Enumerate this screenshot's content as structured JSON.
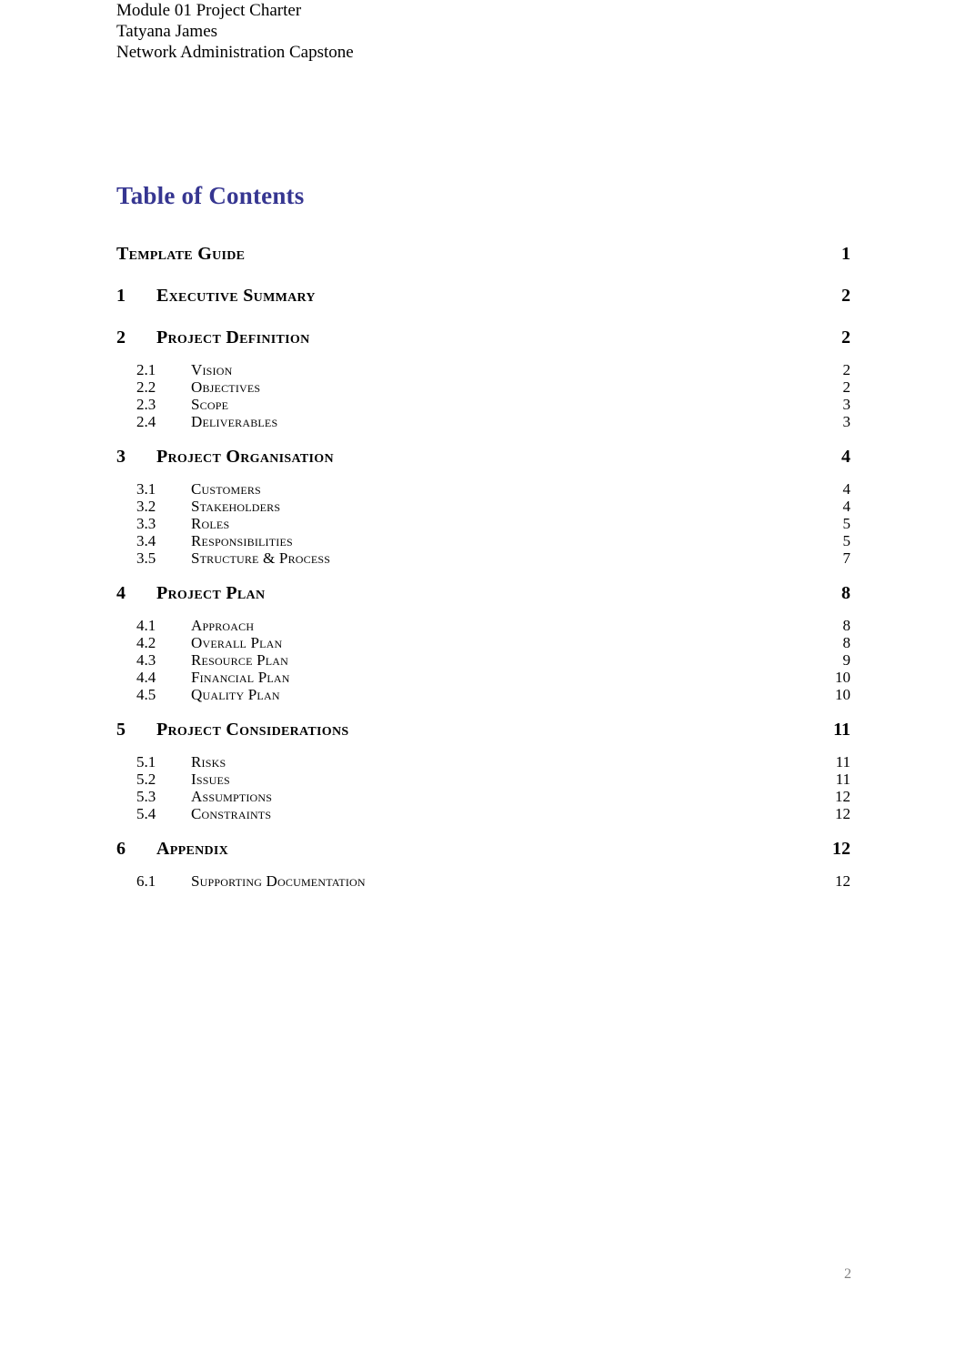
{
  "document": {
    "header_lines": [
      "Module 01 Project Charter",
      "Tatyana James",
      "Network Administration Capstone"
    ],
    "toc_title": "Table of Contents",
    "footer_page_number": "2",
    "title_color": "#363691",
    "footer_color": "#808080"
  },
  "toc": {
    "entries": [
      {
        "level": 1,
        "number": "",
        "label": "Template Guide",
        "page": "1",
        "group_start": false
      },
      {
        "level": 1,
        "number": "1",
        "label": "Executive Summary",
        "page": "2",
        "group_start": true
      },
      {
        "level": 1,
        "number": "2",
        "label": "Project Definition",
        "page": "2",
        "group_start": true
      },
      {
        "level": 2,
        "number": "2.1",
        "label": "Vision",
        "page": "2",
        "group_start": true
      },
      {
        "level": 2,
        "number": "2.2",
        "label": "Objectives",
        "page": "2",
        "group_start": false
      },
      {
        "level": 2,
        "number": "2.3",
        "label": "Scope",
        "page": "3",
        "group_start": false
      },
      {
        "level": 2,
        "number": "2.4",
        "label": "Deliverables",
        "page": "3",
        "group_start": false
      },
      {
        "level": 1,
        "number": "3",
        "label": "Project Organisation",
        "page": "4",
        "group_start": true
      },
      {
        "level": 2,
        "number": "3.1",
        "label": "Customers",
        "page": "4",
        "group_start": true
      },
      {
        "level": 2,
        "number": "3.2",
        "label": "Stakeholders",
        "page": "4",
        "group_start": false
      },
      {
        "level": 2,
        "number": "3.3",
        "label": "Roles",
        "page": "5",
        "group_start": false
      },
      {
        "level": 2,
        "number": "3.4",
        "label": "Responsibilities",
        "page": "5",
        "group_start": false
      },
      {
        "level": 2,
        "number": "3.5",
        "label": "Structure & Process",
        "page": "7",
        "group_start": false
      },
      {
        "level": 1,
        "number": "4",
        "label": "Project Plan",
        "page": "8",
        "group_start": true
      },
      {
        "level": 2,
        "number": "4.1",
        "label": "Approach",
        "page": "8",
        "group_start": true
      },
      {
        "level": 2,
        "number": "4.2",
        "label": "Overall Plan",
        "page": "8",
        "group_start": false
      },
      {
        "level": 2,
        "number": "4.3",
        "label": "Resource Plan",
        "page": "9",
        "group_start": false
      },
      {
        "level": 2,
        "number": "4.4",
        "label": "Financial Plan",
        "page": "10",
        "group_start": false
      },
      {
        "level": 2,
        "number": "4.5",
        "label": "Quality Plan",
        "page": "10",
        "group_start": false
      },
      {
        "level": 1,
        "number": "5",
        "label": "Project Considerations",
        "page": "11",
        "group_start": true
      },
      {
        "level": 2,
        "number": "5.1",
        "label": "Risks",
        "page": "11",
        "group_start": true
      },
      {
        "level": 2,
        "number": "5.2",
        "label": "Issues",
        "page": "11",
        "group_start": false
      },
      {
        "level": 2,
        "number": "5.3",
        "label": "Assumptions",
        "page": "12",
        "group_start": false
      },
      {
        "level": 2,
        "number": "5.4",
        "label": "Constraints",
        "page": "12",
        "group_start": false
      },
      {
        "level": 1,
        "number": "6",
        "label": "Appendix",
        "page": "12",
        "group_start": true
      },
      {
        "level": 2,
        "number": "6.1",
        "label": "Supporting Documentation",
        "page": "12",
        "group_start": true
      }
    ]
  }
}
